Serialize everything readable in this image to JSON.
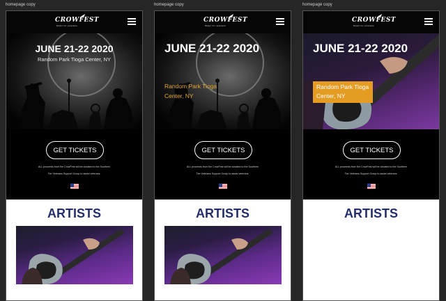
{
  "boards": [
    {
      "title": "homepage copy",
      "logo": {
        "name": "CROWFEST",
        "tagline": "Music for veterans"
      },
      "hero": {
        "date": "JUNE 21-22 2020",
        "venue": "Random Park Tioga Center, NY",
        "style": "dark-silhouette"
      },
      "cta": {
        "label": "GET TICKETS"
      },
      "donation": {
        "line1": "ALL proceeds from the CrowFest will be donated to the Southern",
        "line2": "Tier Veterans Support Group to assist veterans."
      },
      "section": {
        "title": "ARTISTS"
      }
    },
    {
      "title": "homepage copy",
      "logo": {
        "name": "CROWFEST",
        "tagline": "Music for veterans"
      },
      "hero": {
        "date": "JUNE 21-22 2020",
        "venue": "Random Park Tioga Center, NY",
        "style": "dark-silhouette"
      },
      "cta": {
        "label": "GET TICKETS"
      },
      "donation": {
        "line1": "ALL proceeds from the CrowFest will be donated to the Southern",
        "line2": "Tier Veterans Support Group to assist veterans."
      },
      "section": {
        "title": "ARTISTS"
      }
    },
    {
      "title": "homepage copy",
      "logo": {
        "name": "CROWFEST",
        "tagline": "Music for veterans"
      },
      "hero": {
        "date": "JUNE 21-22 2020",
        "venue": "Random Park Tioga Center, NY",
        "style": "guitar-photo"
      },
      "cta": {
        "label": "GET TICKETS"
      },
      "donation": {
        "line1": "ALL proceeds from the CrowFest will be donated to the Southern",
        "line2": "Tier Veterans Support Group to assist veterans."
      },
      "section": {
        "title": "ARTISTS"
      }
    }
  ],
  "colors": {
    "accent_orange": "#e49c22",
    "artists_navy": "#232e6b",
    "hero_black": "#000000"
  },
  "icons": [
    "menu-icon",
    "crow-icon",
    "us-flag-icon"
  ]
}
